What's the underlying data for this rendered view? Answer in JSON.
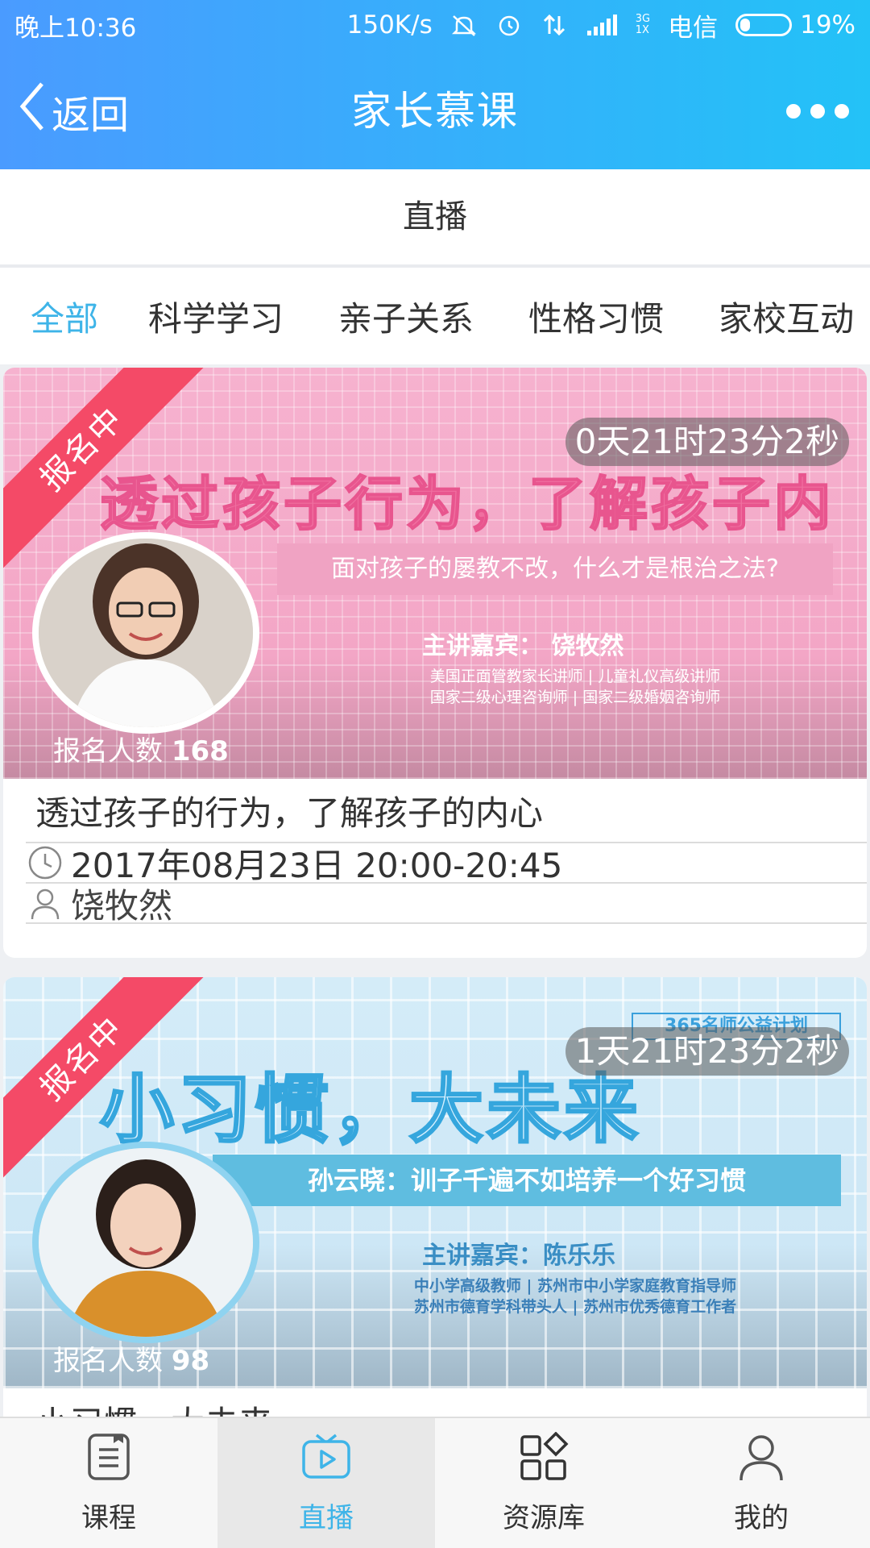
{
  "status_bar": {
    "time": "晚上10:36",
    "speed": "150K/s",
    "network": "3G",
    "network_sub": "1X",
    "carrier": "电信",
    "battery": "19%"
  },
  "header": {
    "back_label": "返回",
    "title": "家长慕课"
  },
  "section_title": "直播",
  "tabs": [
    {
      "label": "全部",
      "active": true
    },
    {
      "label": "科学学习"
    },
    {
      "label": "亲子关系"
    },
    {
      "label": "性格习惯"
    },
    {
      "label": "家校互动"
    }
  ],
  "cards": [
    {
      "ribbon": "报名中",
      "countdown": "0天21时23分2秒",
      "banner_headline": "透过孩子行为，了解孩子内心",
      "banner_subline": "面对孩子的屡教不改，什么才是根治之法?",
      "banner_guest": "主讲嘉宾：   饶牧然",
      "banner_desc_1": "美国正面管教家长讲师 | 儿童礼仪高级讲师",
      "banner_desc_2": "国家二级心理咨询师 | 国家二级婚姻咨询师",
      "count_label": "报名人数",
      "count": "168",
      "title": "透过孩子的行为，了解孩子的内心",
      "time": "2017年08月23日 20:00-20:45",
      "host": "饶牧然"
    },
    {
      "ribbon": "报名中",
      "countdown": "1天21时23分2秒",
      "banner_tag": "365名师公益计划",
      "banner_headline": "小习惯，大未来",
      "banner_subline": "孙云晓：训子千遍不如培养一个好习惯",
      "banner_guest": "主讲嘉宾：陈乐乐",
      "banner_desc_1": "中小学高级教师 | 苏州市中小学家庭教育指导师",
      "banner_desc_2": "苏州市德育学科带头人 | 苏州市优秀德育工作者",
      "count_label": "报名人数",
      "count": "98",
      "title": "小习惯，大未来"
    }
  ],
  "tabbar": [
    {
      "label": "课程",
      "icon": "document-icon"
    },
    {
      "label": "直播",
      "icon": "tv-icon",
      "active": true
    },
    {
      "label": "资源库",
      "icon": "grid-icon"
    },
    {
      "label": "我的",
      "icon": "person-icon"
    }
  ],
  "colors": {
    "accent": "#3eb4e8",
    "ribbon": "#f44a67",
    "header_start": "#4a9bff",
    "header_end": "#23c2f7"
  }
}
